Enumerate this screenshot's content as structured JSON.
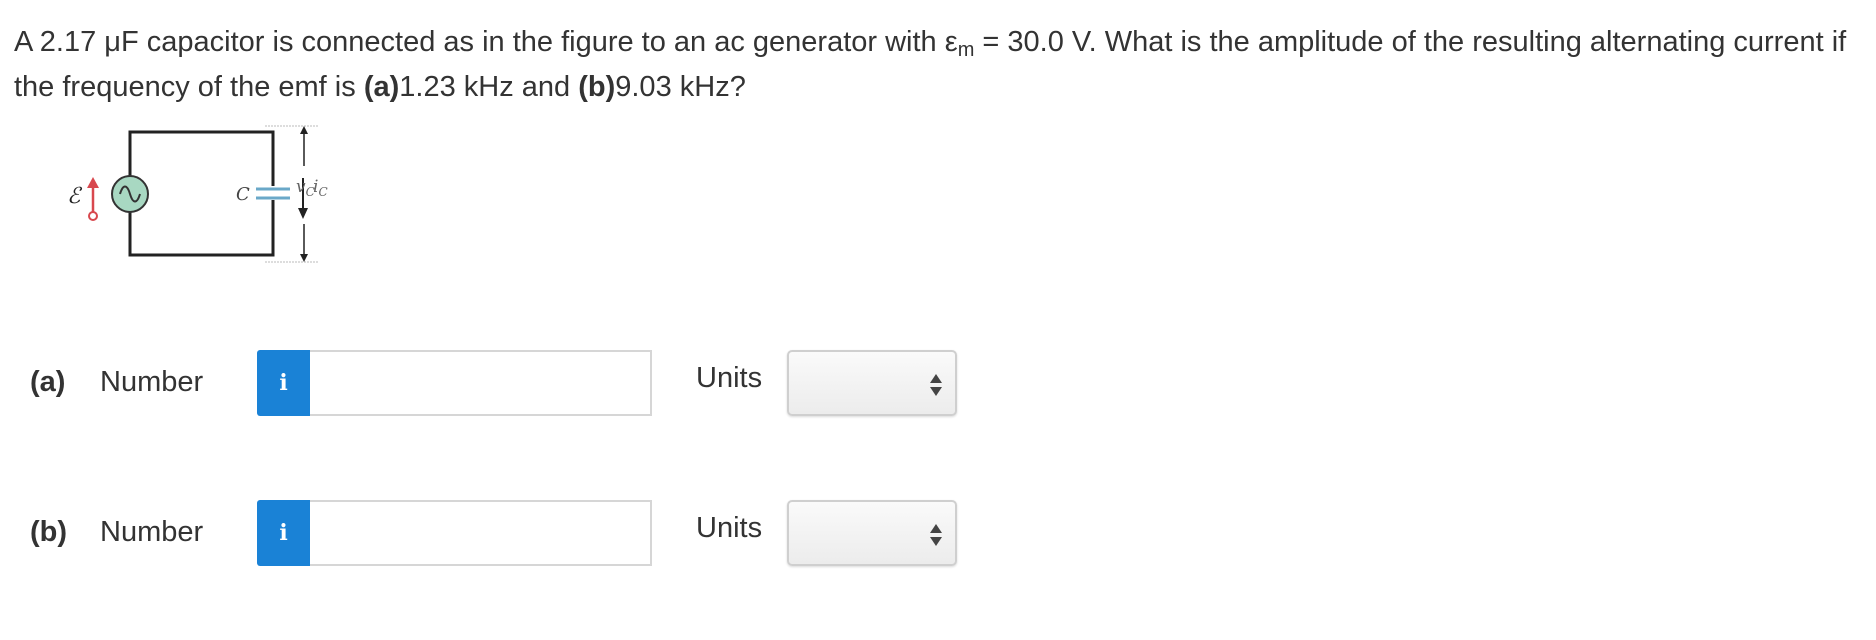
{
  "question": {
    "t1": "A 2.17 μF capacitor is connected as in the figure to an ac generator with ε",
    "t1_sub": "m",
    "t2": " = 30.0 V. What is the amplitude of the resulting alternating current if the frequency of the emf is ",
    "a_label": "(a)",
    "a_value": "1.23 kHz and ",
    "b_label": "(b)",
    "b_value": "9.03 kHz?"
  },
  "figure": {
    "emf_symbol": "ℰ",
    "cap_label": "C",
    "current_label": "i",
    "current_sub": "C",
    "voltage_label": "v",
    "voltage_sub": "C"
  },
  "parts": [
    {
      "label": "(a)",
      "number_label": "Number",
      "info_icon": "i",
      "value": "",
      "units_label": "Units",
      "units_selected": ""
    },
    {
      "label": "(b)",
      "number_label": "Number",
      "info_icon": "i",
      "value": "",
      "units_label": "Units",
      "units_selected": ""
    }
  ],
  "colors": {
    "info_button": "#1a82d6",
    "generator_fill": "#a8d8c2",
    "emf_arrow": "#d8484e"
  }
}
